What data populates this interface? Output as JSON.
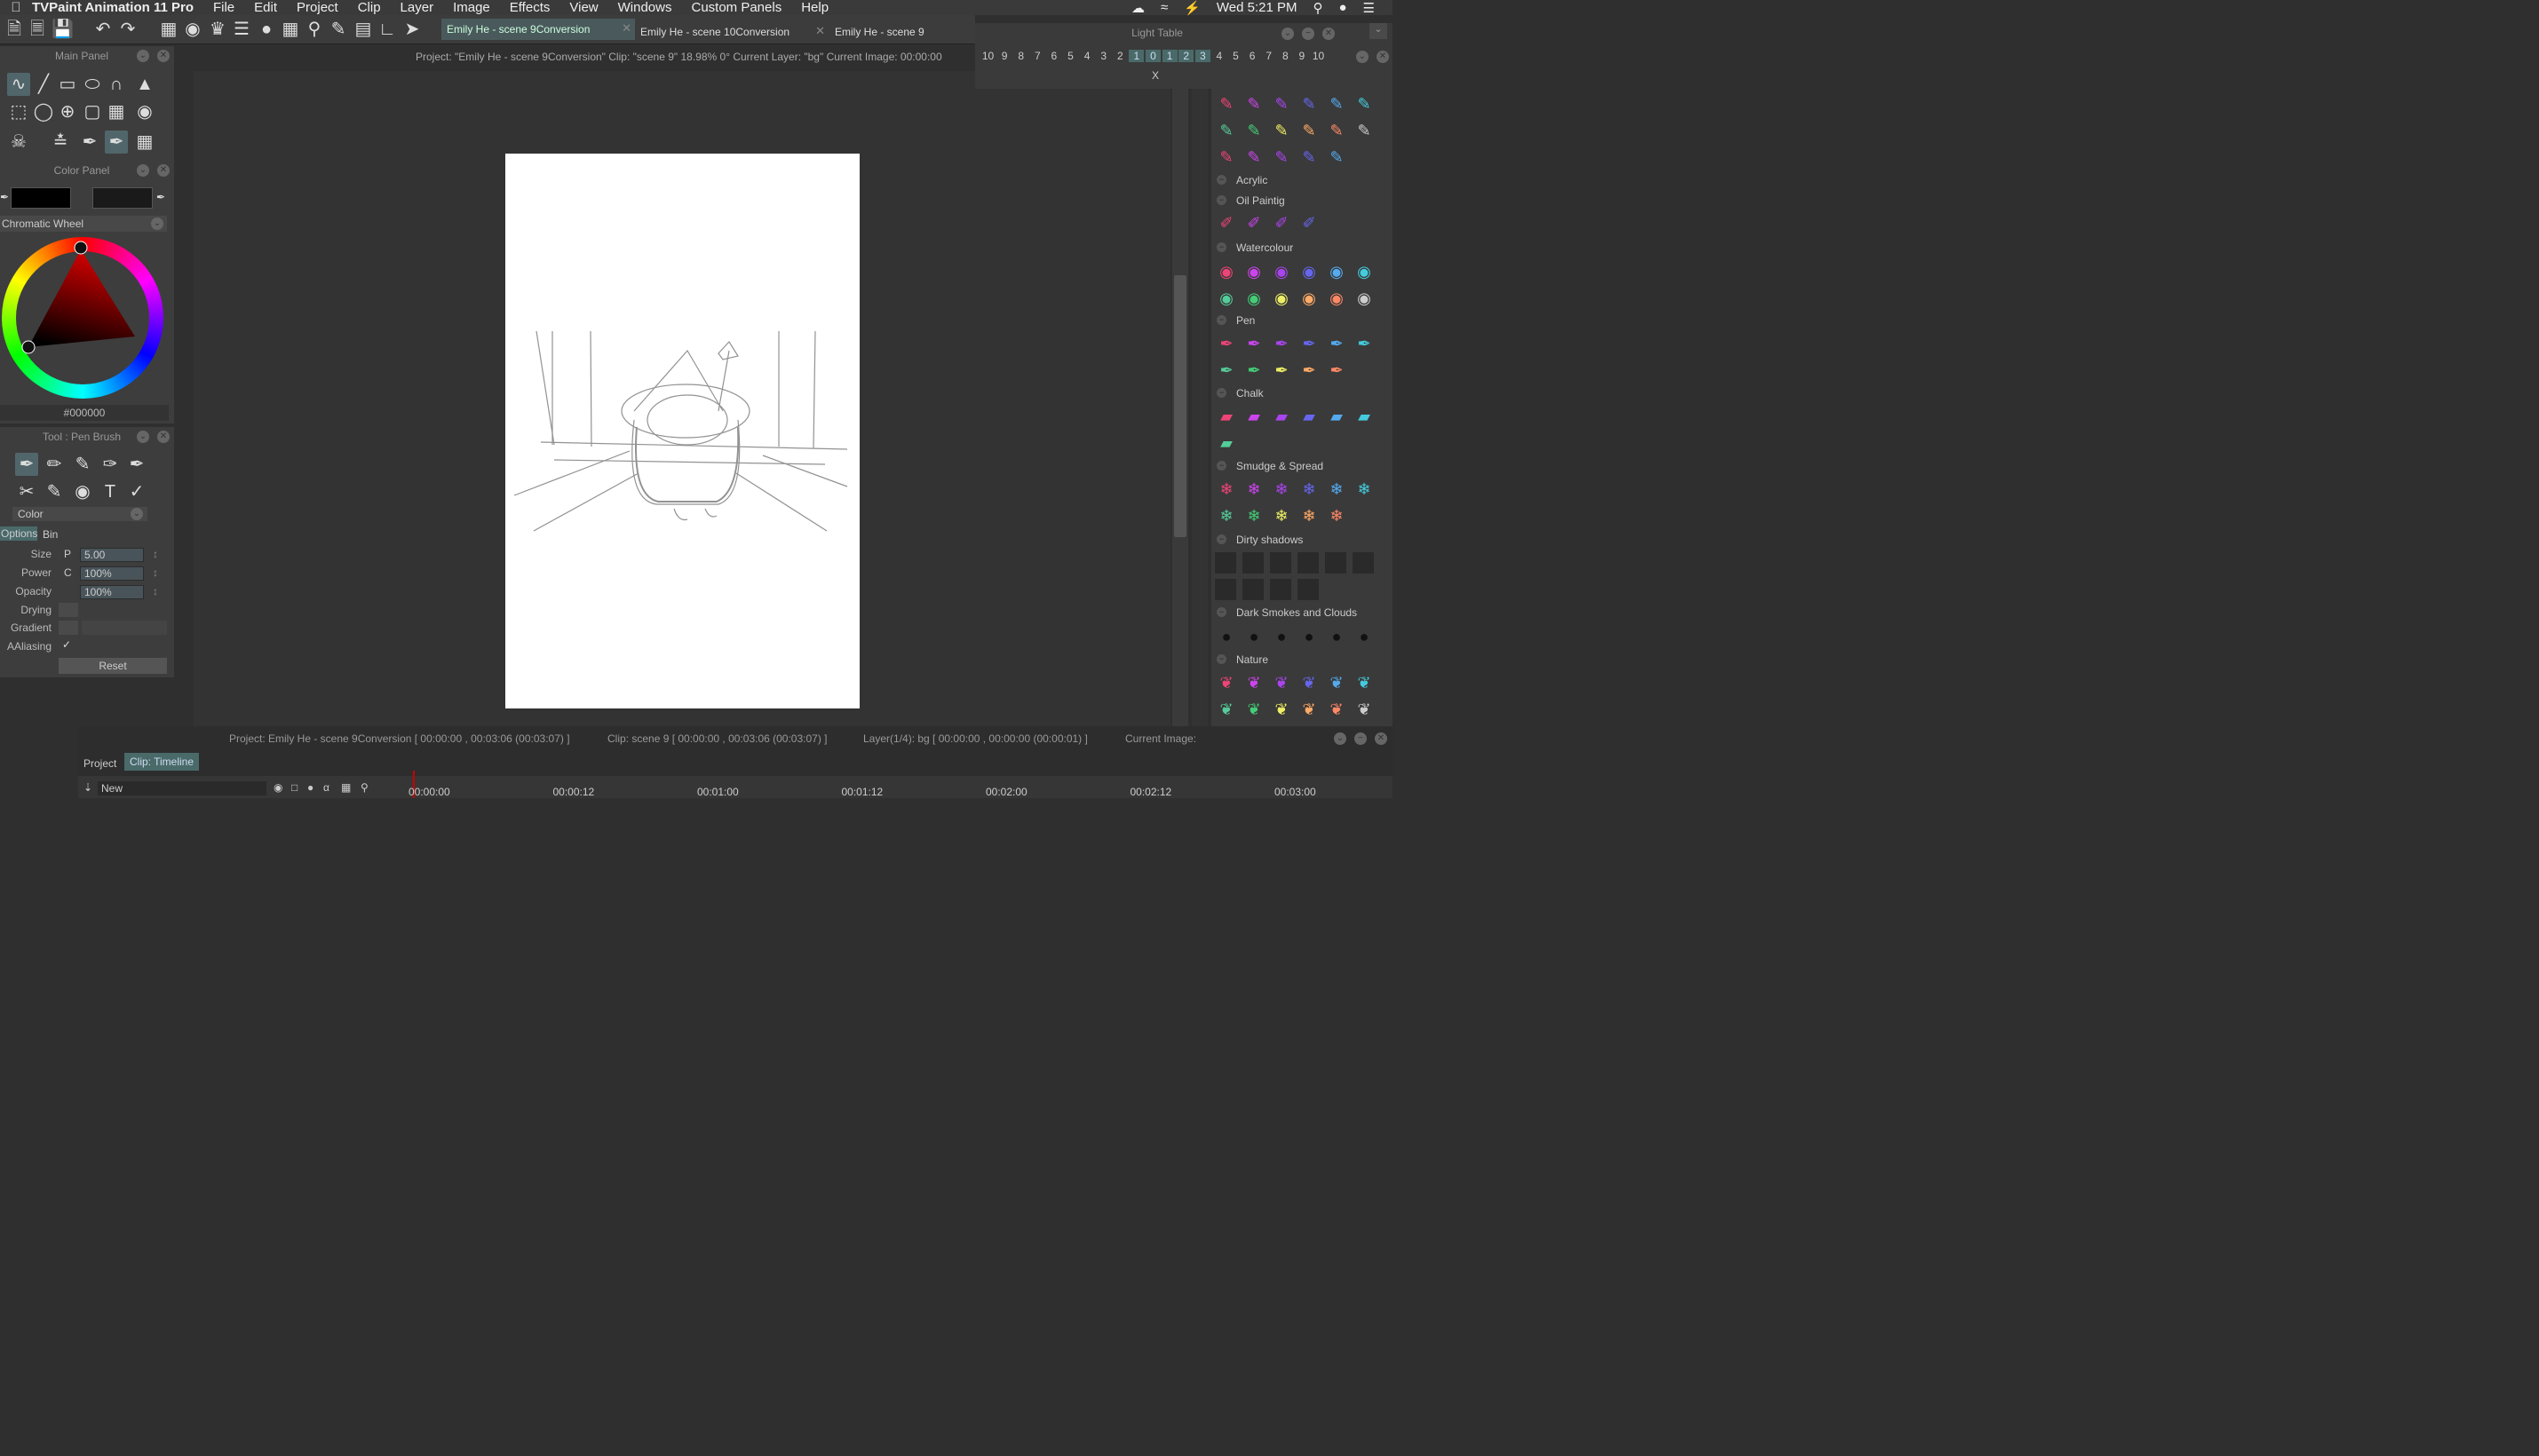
{
  "menubar": {
    "app": "TVPaint Animation 11 Pro",
    "items": [
      "File",
      "Edit",
      "Project",
      "Clip",
      "Layer",
      "Image",
      "Effects",
      "View",
      "Windows",
      "Custom Panels",
      "Help"
    ],
    "clock": "Wed 5:21 PM"
  },
  "tabs": [
    {
      "label": "Emily He - scene 9Conversion"
    },
    {
      "label": "Emily He - scene 10Conversion"
    },
    {
      "label": "Emily He - scene 9"
    }
  ],
  "status_line": "Project: \"Emily He - scene 9Conversion\"  Clip: \"scene 9\"  18.98%  0°  Current Layer: \"bg\"  Current Image: 00:00:00",
  "main_panel": {
    "title": "Main Panel"
  },
  "color_panel": {
    "title": "Color Panel",
    "mode": "Chromatic Wheel",
    "hex": "#000000"
  },
  "tool_panel": {
    "title": "Tool : Pen Brush",
    "color_label": "Color",
    "tab_options": "Options",
    "tab_bin": "Bin",
    "size_label": "Size",
    "size_flag": "P",
    "size_value": "5.00",
    "power_label": "Power",
    "power_flag": "C",
    "power_value": "100%",
    "opacity_label": "Opacity",
    "opacity_value": "100%",
    "drying_label": "Drying",
    "gradient_label": "Gradient",
    "aaliasing_label": "AAliasing",
    "reset_label": "Reset"
  },
  "light_table": {
    "title": "Light Table",
    "numbers": [
      "10",
      "9",
      "8",
      "7",
      "6",
      "5",
      "4",
      "3",
      "2",
      "1",
      "0",
      "1",
      "2",
      "3",
      "4",
      "5",
      "6",
      "7",
      "8",
      "9",
      "10"
    ],
    "center_mark": "X"
  },
  "brush_categories": [
    "Acrylic",
    "Oil Paintig",
    "Watercolour",
    "Pen",
    "Chalk",
    "Smudge & Spread",
    "Dirty shadows",
    "Dark Smokes and Clouds",
    "Nature"
  ],
  "bottom": {
    "project_info": "Project: Emily He - scene 9Conversion [ 00:00:00 , 00:03:06  (00:03:07) ]",
    "clip_info": "Clip: scene 9 [ 00:00:00 , 00:03:06  (00:03:07) ]",
    "layer_info": "Layer(1/4): bg [ 00:00:00 , 00:00:00  (00:00:01) ]",
    "current_image": "Current Image:",
    "tab_project": "Project",
    "tab_timeline": "Clip: Timeline",
    "new_label": "New",
    "ticks": [
      "00:00:00",
      "00:00:12",
      "00:01:00",
      "00:01:12",
      "00:02:00",
      "00:02:12",
      "00:03:00"
    ]
  },
  "colors": {
    "accent": "#4a6a6a",
    "selected_tool": "#51666a",
    "panel_bg": "#3d3d3d",
    "canvas_bg": "#333333"
  }
}
